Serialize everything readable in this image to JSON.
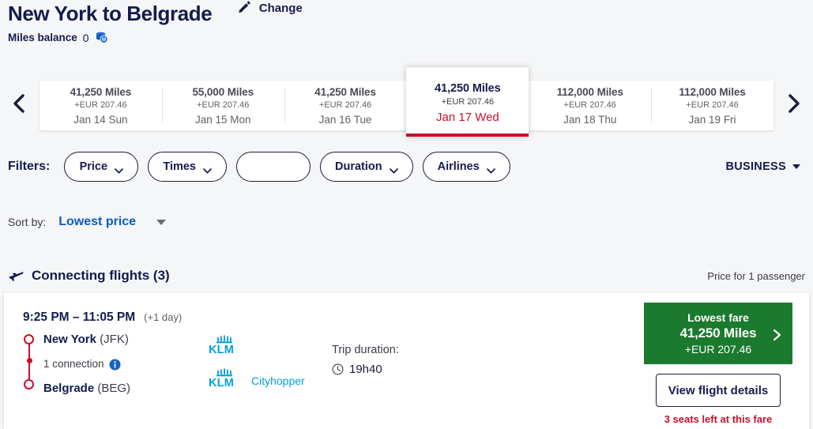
{
  "header": {
    "route_title": "New York to Belgrade",
    "change_label": "Change",
    "miles_label": "Miles balance",
    "miles_value": "0",
    "miles_icon": "coins-icon",
    "pencil_icon": "pencil-icon"
  },
  "carousel": {
    "prev_icon": "chevron-left-icon",
    "next_icon": "chevron-right-icon",
    "dates": [
      {
        "miles": "41,250 Miles",
        "eur": "+EUR 207.46",
        "date": "Jan 14 Sun",
        "selected": false
      },
      {
        "miles": "55,000 Miles",
        "eur": "+EUR 207.46",
        "date": "Jan 15 Mon",
        "selected": false
      },
      {
        "miles": "41,250 Miles",
        "eur": "+EUR 207.46",
        "date": "Jan 16 Tue",
        "selected": false
      },
      {
        "miles": "41,250 Miles",
        "eur": "+EUR 207.46",
        "date": "Jan 17 Wed",
        "selected": true
      },
      {
        "miles": "112,000 Miles",
        "eur": "+EUR 207.46",
        "date": "Jan 18 Thu",
        "selected": false
      },
      {
        "miles": "112,000 Miles",
        "eur": "+EUR 207.46",
        "date": "Jan 19 Fri",
        "selected": false
      }
    ]
  },
  "filters": {
    "label": "Filters:",
    "pills": [
      {
        "label": "Price",
        "has_caret": true
      },
      {
        "label": "Times",
        "has_caret": true
      },
      {
        "label": "",
        "has_caret": false
      },
      {
        "label": "Duration",
        "has_caret": true
      },
      {
        "label": "Airlines",
        "has_caret": true
      }
    ],
    "cabin_class": "BUSINESS"
  },
  "sort": {
    "label": "Sort by:",
    "value": "Lowest price"
  },
  "results_header": {
    "plane_icon": "plane-icon",
    "title": "Connecting flights (3)",
    "price_note": "Price for 1 passenger"
  },
  "flight": {
    "times": "9:25 PM – 11:05 PM",
    "plus_day": "(+1 day)",
    "origin_city": "New York",
    "origin_code": "(JFK)",
    "connections": "1 connection",
    "info_icon": "info-icon",
    "dest_city": "Belgrade",
    "dest_code": "(BEG)",
    "airlines": [
      {
        "logo": "klm-logo",
        "sub": ""
      },
      {
        "logo": "klm-logo",
        "sub": "Cityhopper"
      }
    ],
    "duration_label": "Trip duration:",
    "duration_value": "19h40",
    "clock_icon": "clock-icon",
    "fare": {
      "top": "Lowest fare",
      "miles": "41,250 Miles",
      "eur": "+EUR 207.46",
      "chevron_icon": "chevron-right-icon"
    },
    "details_button": "View flight details",
    "seats_left": "3 seats left at this fare"
  },
  "colors": {
    "brand_navy": "#141b4d",
    "accent_red": "#c8102e",
    "fare_green": "#1a7a2e",
    "klm_blue": "#00a1de",
    "link_blue": "#0d5bc4",
    "page_bg": "#f5f6f7"
  }
}
